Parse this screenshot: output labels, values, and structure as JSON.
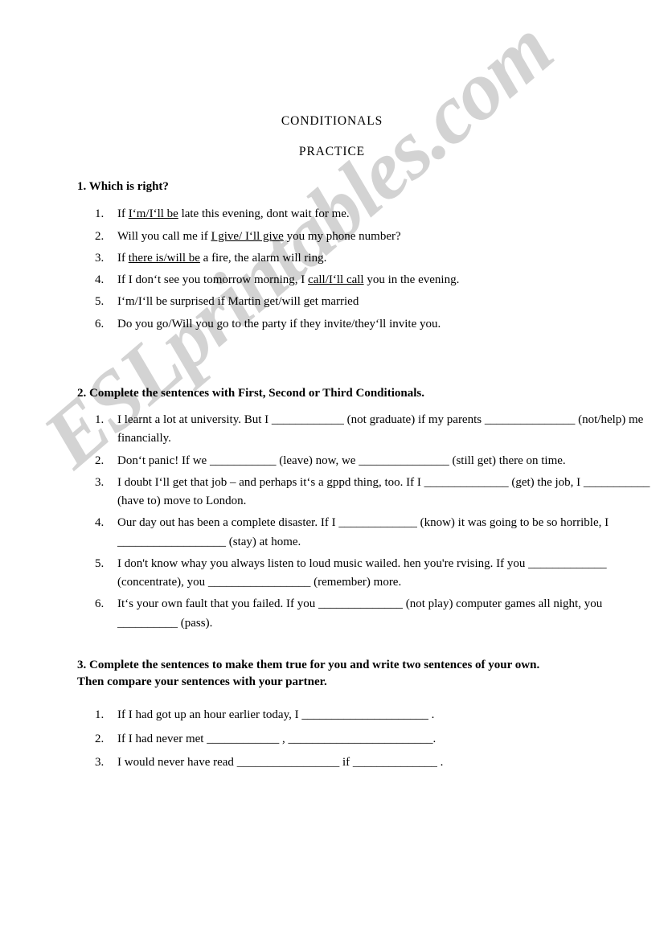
{
  "document": {
    "title": "CONDITIONALS",
    "subtitle": "PRACTICE",
    "watermark": "ESLprintables.com",
    "watermark_color": "#d3d3d3"
  },
  "sections": [
    {
      "heading": "1. Which is right?",
      "items": [
        {
          "number": "1.",
          "pre": "If ",
          "underlined": "I‘m/I‘ll be",
          "post": " late this evening, dont wait for me."
        },
        {
          "number": "2.",
          "pre": "Will you call me if ",
          "underlined": "I give/ I‘ll give",
          "post": " you my phone number?"
        },
        {
          "number": "3.",
          "pre": "If ",
          "underlined": "there is/will be",
          "post": " a fire, the alarm will ring."
        },
        {
          "number": "4.",
          "pre": "If I don‘t see you tomorrow morning, I ",
          "underlined": "call/I‘ll call",
          "post": " you in the evening."
        },
        {
          "number": "5.",
          "pre": " I‘m/I‘ll be surprised if Martin get/will get married",
          "underlined": "",
          "post": ""
        },
        {
          "number": "6.",
          "pre": "Do you go/Will you go to the party if they invite/they‘ll invite you.",
          "underlined": "",
          "post": ""
        }
      ]
    },
    {
      "heading": "2. Complete the sentences with First, Second or Third Conditionals.",
      "items": [
        {
          "number": "1.",
          "parts": [
            {
              "t": "text",
              "v": "I learnt a lot at university. But I "
            },
            {
              "t": "blank",
              "v": "____________"
            },
            {
              "t": "text",
              "v": " (not graduate) if my parents "
            },
            {
              "t": "blank",
              "v": "_______________"
            },
            {
              "t": "text",
              "v": " (not/help) me financially."
            }
          ]
        },
        {
          "number": "2.",
          "parts": [
            {
              "t": "text",
              "v": "Don‘t panic! If we "
            },
            {
              "t": "blank",
              "v": "___________"
            },
            {
              "t": "text",
              "v": " (leave) now, we "
            },
            {
              "t": "blank",
              "v": "_______________"
            },
            {
              "t": "text",
              "v": " (still get) there on time."
            }
          ]
        },
        {
          "number": "3.",
          "parts": [
            {
              "t": "text",
              "v": "I doubt I‘ll get that job – and perhaps it‘s a gppd thing, too. If I "
            },
            {
              "t": "blank",
              "v": "______________"
            },
            {
              "t": "text",
              "v": " (get) the job, I "
            },
            {
              "t": "blank",
              "v": "___________"
            },
            {
              "t": "text",
              "v": " (have to) move to London."
            }
          ]
        },
        {
          "number": "4.",
          "parts": [
            {
              "t": "text",
              "v": "Our day out has been a complete disaster. If I "
            },
            {
              "t": "blank",
              "v": "_____________"
            },
            {
              "t": "text",
              "v": " (know) it was going to be so horrible, I "
            },
            {
              "t": "blank",
              "v": "__________________"
            },
            {
              "t": "text",
              "v": " (stay) at home."
            }
          ]
        },
        {
          "number": "5.",
          "parts": [
            {
              "t": "text",
              "v": "I don't know whay you always listen to loud music wailed. hen you're rvising. If you "
            },
            {
              "t": "blank",
              "v": "_____________"
            },
            {
              "t": "text",
              "v": " (concentrate), you "
            },
            {
              "t": "blank",
              "v": "_________________"
            },
            {
              "t": "text",
              "v": " (remember) more."
            }
          ]
        },
        {
          "number": "6.",
          "parts": [
            {
              "t": "text",
              "v": "It‘s your own fault that you failed. If you "
            },
            {
              "t": "blank",
              "v": "______________"
            },
            {
              "t": "text",
              "v": " (not play) computer games all night, you "
            },
            {
              "t": "blank",
              "v": "__________"
            },
            {
              "t": "text",
              "v": " (pass)."
            }
          ]
        }
      ]
    },
    {
      "heading_line1": "3. Complete the sentences to make them true for you and write two sentences of your own.",
      "heading_line2": "Then compare your sentences with your partner.",
      "items": [
        {
          "number": "1.",
          "parts": [
            {
              "t": "text",
              "v": "If I had got up an hour earlier today, I "
            },
            {
              "t": "blank",
              "v": "_____________________"
            },
            {
              "t": "text",
              "v": " ."
            }
          ]
        },
        {
          "number": "2.",
          "parts": [
            {
              "t": "text",
              "v": "If I had never met "
            },
            {
              "t": "blank",
              "v": "____________"
            },
            {
              "t": "text",
              "v": " , "
            },
            {
              "t": "blank",
              "v": "________________________"
            },
            {
              "t": "text",
              "v": "."
            }
          ]
        },
        {
          "number": "3.",
          "parts": [
            {
              "t": "text",
              "v": "I would never have read "
            },
            {
              "t": "blank",
              "v": "_________________"
            },
            {
              "t": "text",
              "v": " if "
            },
            {
              "t": "blank",
              "v": "______________"
            },
            {
              "t": "text",
              "v": " ."
            }
          ]
        }
      ]
    }
  ]
}
